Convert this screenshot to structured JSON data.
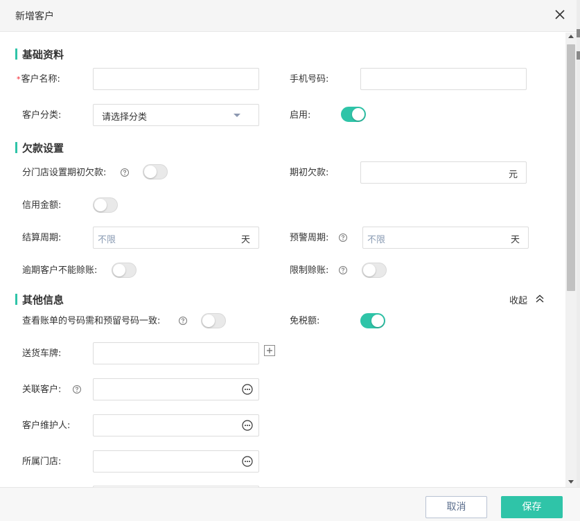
{
  "dialog": {
    "title": "新增客户",
    "close_icon": "close-icon"
  },
  "sections": {
    "basic": "基础资料",
    "debt": "欠款设置",
    "other": "其他信息"
  },
  "basic": {
    "customer_name_required": "*",
    "customer_name_label": "客户名称:",
    "customer_name_value": "",
    "phone_label": "手机号码:",
    "phone_value": "",
    "category_label": "客户分类:",
    "category_value": "请选择分类",
    "enable_label": "启用:",
    "enable_on": true
  },
  "debt": {
    "branch_opening_label": "分门店设置期初欠款:",
    "branch_opening_on": false,
    "opening_debt_label": "期初欠款:",
    "opening_debt_value": "",
    "opening_debt_unit": "元",
    "credit_label": "信用金额:",
    "credit_on": false,
    "settle_period_label": "结算周期:",
    "settle_period_value": "不限",
    "settle_period_unit": "天",
    "warn_period_label": "预警周期:",
    "warn_period_value": "不限",
    "warn_period_unit": "天",
    "overdue_label": "逾期客户不能赊账:",
    "overdue_on": false,
    "limit_credit_label": "限制赊账:",
    "limit_credit_on": false
  },
  "other": {
    "collapse_label": "收起",
    "check_bill_label": "查看账单的号码需和预留号码一致:",
    "check_bill_on": false,
    "tax_free_label": "免税额:",
    "tax_free_on": true,
    "plate_label": "送货车牌:",
    "plate_value": "",
    "related_label": "关联客户:",
    "related_value": "",
    "maintainer_label": "客户维护人:",
    "maintainer_value": "",
    "store_label": "所属门店:",
    "store_value": ""
  },
  "footer": {
    "cancel": "取消",
    "save": "保存"
  },
  "colors": {
    "accent": "#2fc4a8",
    "placeholder": "#8a9bb3",
    "required": "#f5222d"
  }
}
